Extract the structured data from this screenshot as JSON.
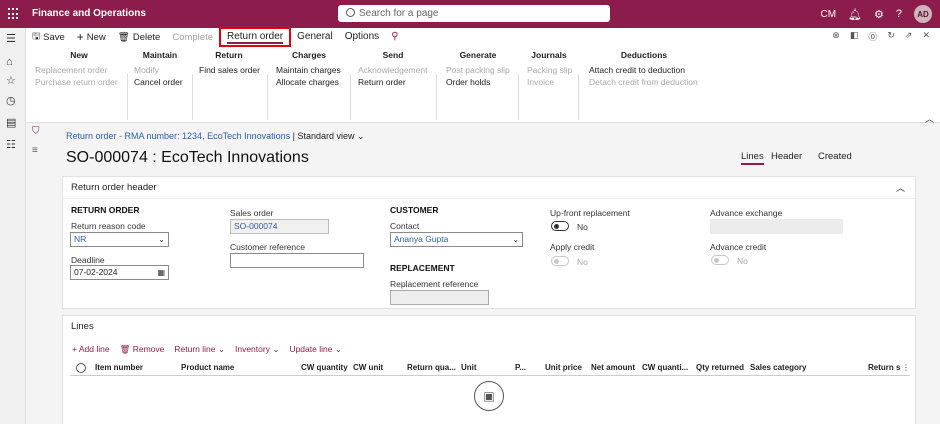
{
  "app": {
    "title": "Finance and Operations",
    "search_placeholder": "Search for a page",
    "company": "CM",
    "avatar": "AD"
  },
  "cmdbar": {
    "save": "Save",
    "new": "New",
    "delete": "Delete",
    "complete": "Complete",
    "tabs": [
      "Return order",
      "General",
      "Options"
    ]
  },
  "groups": {
    "new": {
      "title": "New",
      "items": [
        "Replacement order",
        "Purchase return order"
      ]
    },
    "maintain": {
      "title": "Maintain",
      "items": [
        "Modify",
        "Cancel order"
      ]
    },
    "return": {
      "title": "Return",
      "items": [
        "Find sales order"
      ]
    },
    "charges": {
      "title": "Charges",
      "items": [
        "Maintain charges",
        "Allocate charges"
      ]
    },
    "send": {
      "title": "Send",
      "items": [
        "Acknowledgement",
        "Return order"
      ]
    },
    "generate": {
      "title": "Generate",
      "items": [
        "Post packing slip",
        "Order holds"
      ]
    },
    "journals": {
      "title": "Journals",
      "items": [
        "Packing slip",
        "Invoice"
      ]
    },
    "deductions": {
      "title": "Deductions",
      "items": [
        "Attach credit to deduction",
        "Detach credit from deduction"
      ]
    }
  },
  "page": {
    "breadcrumb": "Return order - RMA number: 1234, EcoTech Innovations",
    "view": "Standard view",
    "title": "SO-000074 : EcoTech Innovations",
    "view_tabs": [
      "Lines",
      "Header",
      "Created"
    ]
  },
  "header_card": {
    "title": "Return order header",
    "return_order_label": "RETURN ORDER",
    "reason_label": "Return reason code",
    "reason_value": "NR",
    "deadline_label": "Deadline",
    "deadline_value": "07-02-2024",
    "sales_order_label": "Sales order",
    "sales_order_value": "SO-000074",
    "customer_ref_label": "Customer reference",
    "customer_ref_value": "",
    "customer_label": "CUSTOMER",
    "contact_label": "Contact",
    "contact_value": "Ananya Gupta",
    "replacement_label": "REPLACEMENT",
    "replacement_ref_label": "Replacement reference",
    "upfront_label": "Up-front replacement",
    "upfront_value": "No",
    "apply_credit_label": "Apply credit",
    "apply_credit_value": "No",
    "advance_exchange_label": "Advance exchange",
    "advance_credit_label": "Advance credit",
    "advance_credit_value": "No"
  },
  "lines_card": {
    "title": "Lines",
    "actions": [
      "+ Add line",
      "Remove",
      "Return line",
      "Inventory",
      "Update line"
    ],
    "columns": [
      "Item number",
      "Product name",
      "CW quantity",
      "CW unit",
      "Return qua...",
      "Unit",
      "P...",
      "Unit price",
      "Net amount",
      "CW quanti...",
      "Qty returned",
      "Sales category",
      "Return s"
    ]
  }
}
